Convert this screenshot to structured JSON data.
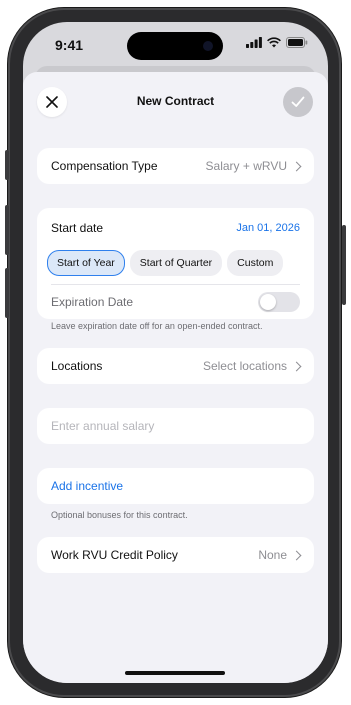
{
  "status_bar": {
    "time": "9:41"
  },
  "nav": {
    "title": "New Contract"
  },
  "compensation": {
    "label": "Compensation Type",
    "value": "Salary + wRVU"
  },
  "dates": {
    "start_label": "Start date",
    "start_value": "Jan 01, 2026",
    "presets": [
      "Start of Year",
      "Start of Quarter",
      "Custom"
    ],
    "selected_preset": "Start of Year",
    "expiration_label": "Expiration Date",
    "expiration_enabled": false,
    "note": "Leave expiration date off for an open-ended contract."
  },
  "locations": {
    "label": "Locations",
    "value": "Select locations"
  },
  "salary": {
    "placeholder": "Enter annual salary"
  },
  "incentive": {
    "add_label": "Add incentive",
    "note": "Optional bonuses for this contract."
  },
  "wrvu_policy": {
    "label": "Work RVU Credit Policy",
    "value": "None"
  },
  "colors": {
    "accent": "#1a73e8",
    "sheet_bg": "#f2f2f7",
    "card_bg": "#ffffff",
    "selected_pill_border": "#2f80ed"
  }
}
